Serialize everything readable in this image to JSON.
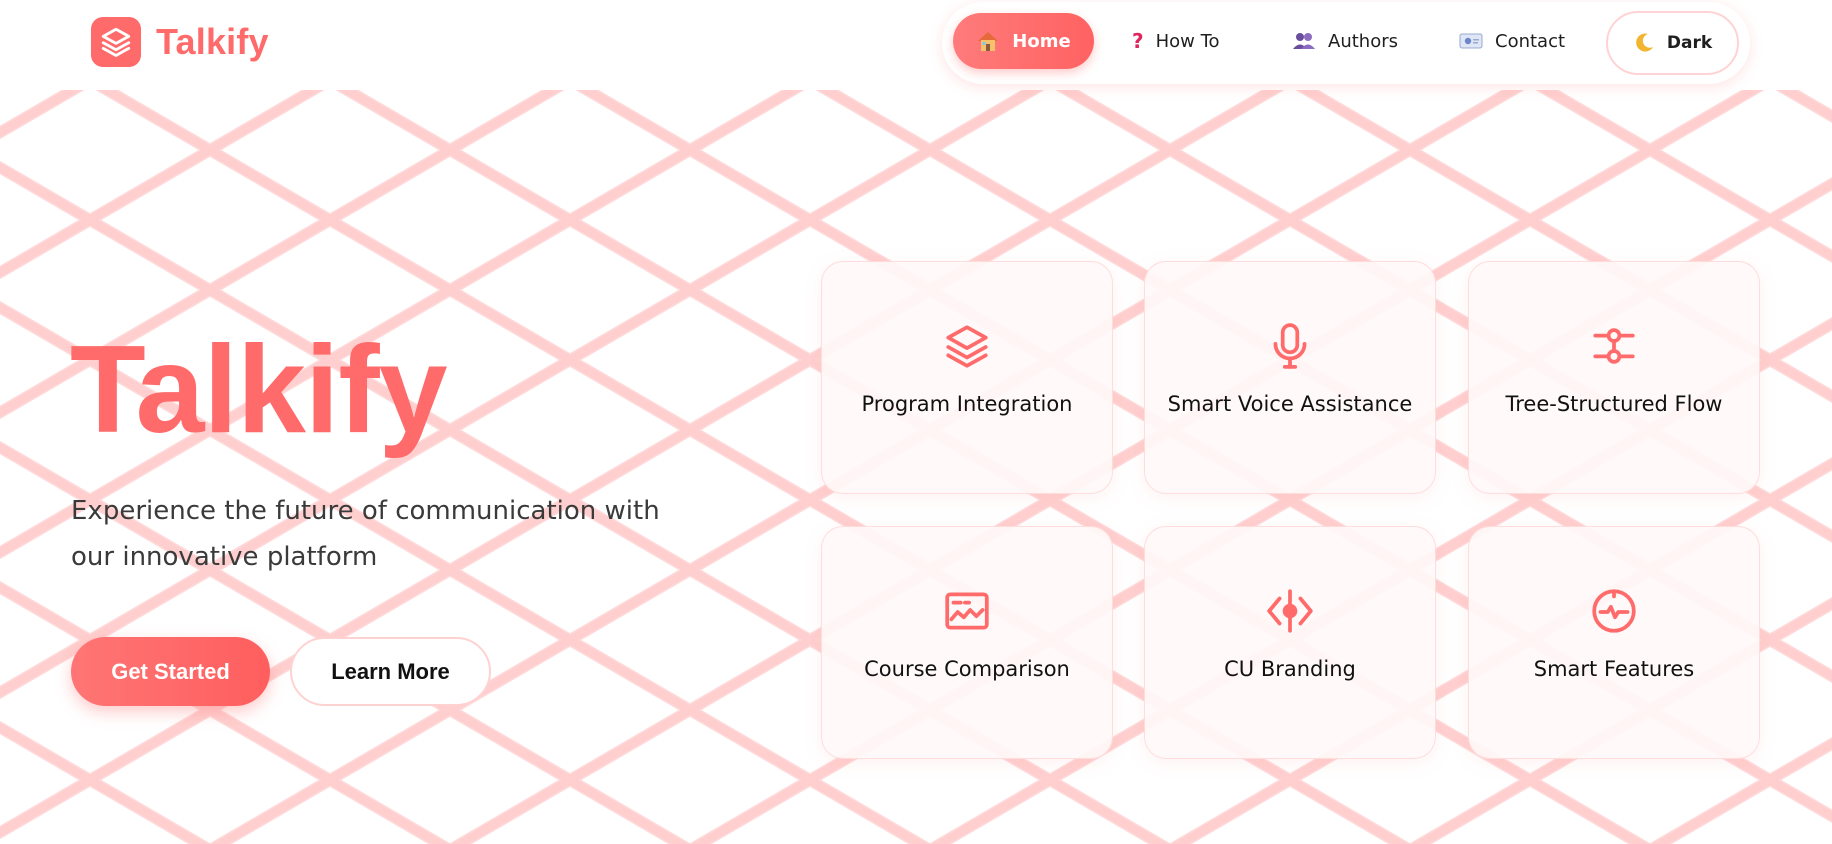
{
  "colors": {
    "accent": "#ff6b6b",
    "text": "#111111",
    "subtext": "#3a3a3a",
    "pattern_glow": "#ffcccc"
  },
  "header": {
    "brand": {
      "name": "Talkify",
      "logo_icon": "layers-icon"
    },
    "nav": [
      {
        "label": "Home",
        "icon": "house-icon",
        "active": true
      },
      {
        "label": "How To",
        "icon": "question-mark-icon",
        "active": false
      },
      {
        "label": "Authors",
        "icon": "people-icon",
        "active": false
      },
      {
        "label": "Contact",
        "icon": "id-card-icon",
        "active": false
      }
    ],
    "theme_toggle": {
      "label": "Dark",
      "icon": "crescent-moon-icon"
    }
  },
  "hero": {
    "title": "Talkify",
    "subtitle": "Experience the future of communication with our innovative platform",
    "primary_button": "Get Started",
    "secondary_button": "Learn More"
  },
  "features": [
    {
      "label": "Program Integration",
      "icon": "layers-icon"
    },
    {
      "label": "Smart Voice Assistance",
      "icon": "microphone-icon"
    },
    {
      "label": "Tree-Structured Flow",
      "icon": "sliders-icon"
    },
    {
      "label": "Course Comparison",
      "icon": "chart-image-icon"
    },
    {
      "label": "CU Branding",
      "icon": "diamond-target-icon"
    },
    {
      "label": "Smart Features",
      "icon": "activity-circle-icon"
    }
  ]
}
